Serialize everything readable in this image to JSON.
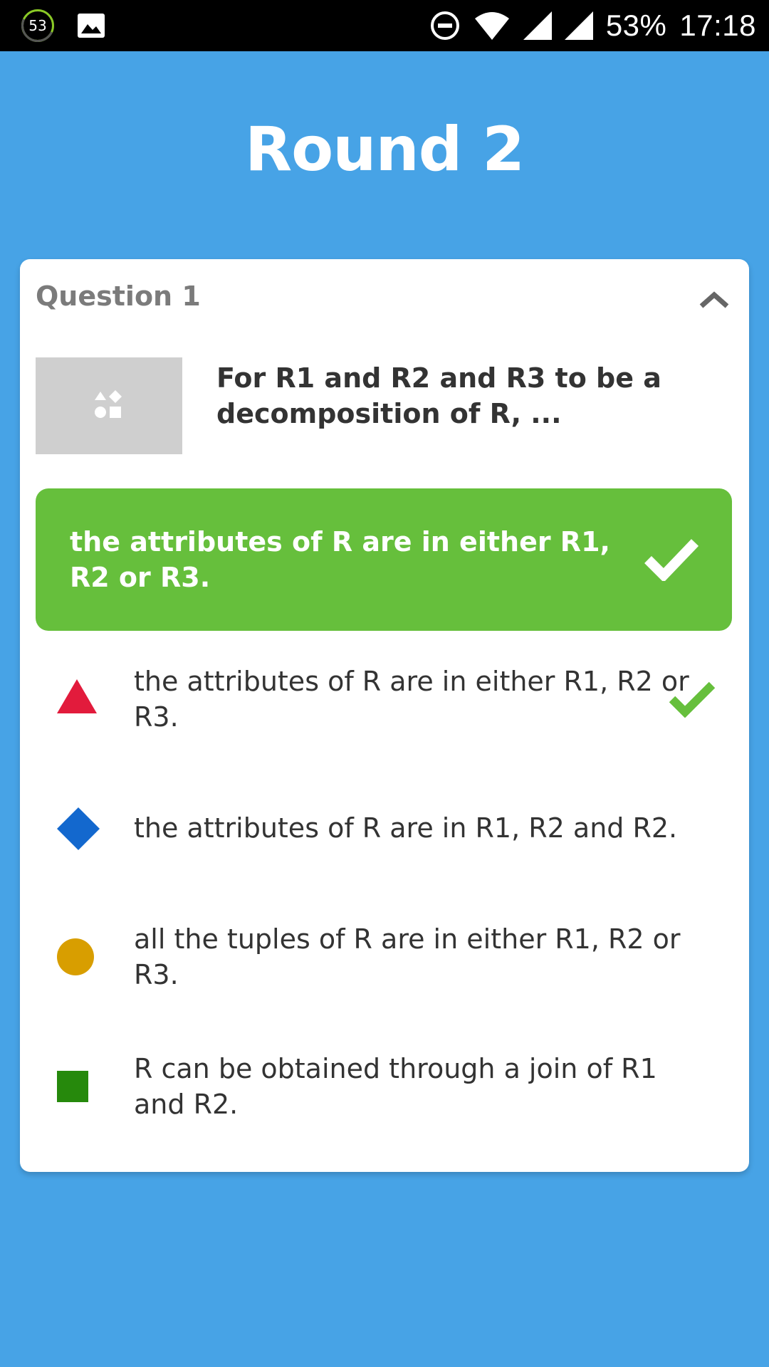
{
  "status_bar": {
    "notification_count": "53",
    "battery": "53%",
    "time": "17:18",
    "icons": [
      "circle-badge-icon",
      "image-icon",
      "do-not-disturb-icon",
      "wifi-icon",
      "signal-icon",
      "signal-icon"
    ]
  },
  "title": "Round 2",
  "question": {
    "label": "Question 1",
    "text": "For R1 and R2 and R3 to be a decomposition of R, ...",
    "correct_answer": "the attributes of R are in either R1, R2 or R3."
  },
  "options": [
    {
      "text": "the attributes of R are in either R1, R2 or R3.",
      "shape": "triangle",
      "color": "#e21b3c",
      "correct": true
    },
    {
      "text": "the attributes of R are in R1, R2 and R2.",
      "shape": "diamond",
      "color": "#1368ce",
      "correct": false
    },
    {
      "text": "all the tuples of R are in either R1, R2 or R3.",
      "shape": "circle",
      "color": "#d89e00",
      "correct": false
    },
    {
      "text": "R can be obtained through a join of R1 and R2.",
      "shape": "square",
      "color": "#26890c",
      "correct": false
    }
  ],
  "colors": {
    "background": "#47a3e6",
    "correct_green": "#66bf3c",
    "card": "#ffffff"
  }
}
